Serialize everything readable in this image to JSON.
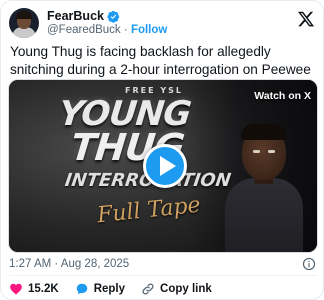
{
  "author": {
    "name": "FearBuck",
    "handle": "@FearedBuck",
    "separator": "·",
    "follow_label": "Follow"
  },
  "tweet": {
    "text": "Young Thug is facing backlash for allegedly snitching during a 2-hour interrogation on Peewee Roscoe"
  },
  "media": {
    "watch_label": "Watch on X",
    "overlay_small": "FREE YSL",
    "overlay_line1": "YOUNG",
    "overlay_line2": "THUG",
    "overlay_line3": "INTERROGATION",
    "overlay_line4": "Full Tape"
  },
  "timestamp": "1:27 AM · Aug 28, 2025",
  "actions": {
    "like_count": "15.2K",
    "reply_label": "Reply",
    "copy_label": "Copy link"
  },
  "colors": {
    "accent": "#1d9bf0",
    "like": "#f91880",
    "text": "#0f1419",
    "secondary": "#536471"
  },
  "icons": {
    "verified": "verified-badge-icon",
    "x_logo": "x-logo-icon",
    "play": "play-icon",
    "info": "info-icon",
    "heart": "heart-icon",
    "reply": "reply-icon",
    "link": "link-icon"
  }
}
